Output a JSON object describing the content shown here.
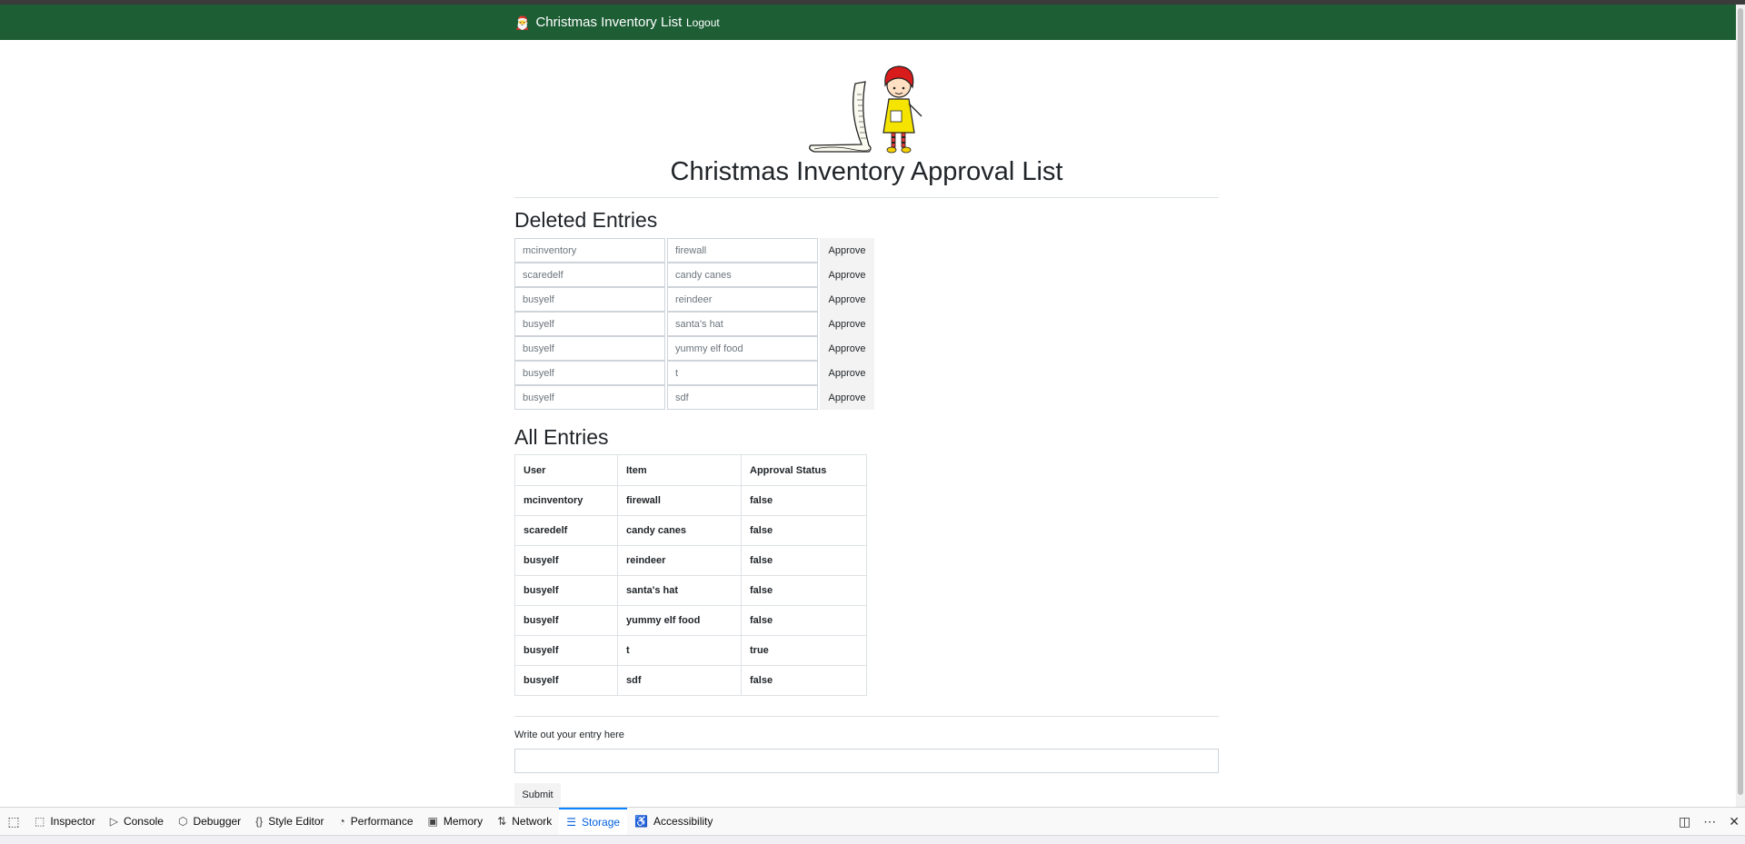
{
  "navbar": {
    "brand": "Christmas Inventory List",
    "logout": "Logout"
  },
  "page": {
    "title": "Christmas Inventory Approval List",
    "deleted_heading": "Deleted Entries",
    "all_heading": "All Entries"
  },
  "deleted_entries": [
    {
      "user": "mcinventory",
      "item": "firewall",
      "button": "Approve"
    },
    {
      "user": "scaredelf",
      "item": "candy canes",
      "button": "Approve"
    },
    {
      "user": "busyelf",
      "item": "reindeer",
      "button": "Approve"
    },
    {
      "user": "busyelf",
      "item": "santa's hat",
      "button": "Approve"
    },
    {
      "user": "busyelf",
      "item": "yummy elf food",
      "button": "Approve"
    },
    {
      "user": "busyelf",
      "item": "t",
      "button": "Approve"
    },
    {
      "user": "busyelf",
      "item": "sdf",
      "button": "Approve"
    }
  ],
  "table": {
    "headers": [
      "User",
      "Item",
      "Approval Status"
    ],
    "rows": [
      [
        "mcinventory",
        "firewall",
        "false"
      ],
      [
        "scaredelf",
        "candy canes",
        "false"
      ],
      [
        "busyelf",
        "reindeer",
        "false"
      ],
      [
        "busyelf",
        "santa's hat",
        "false"
      ],
      [
        "busyelf",
        "yummy elf food",
        "false"
      ],
      [
        "busyelf",
        "t",
        "true"
      ],
      [
        "busyelf",
        "sdf",
        "false"
      ]
    ]
  },
  "form": {
    "label": "Write out your entry here",
    "value": "",
    "submit": "Submit"
  },
  "devtools": {
    "tabs": [
      {
        "label": "Inspector",
        "icon": "inspector-icon",
        "glyph": "⬚",
        "active": false
      },
      {
        "label": "Console",
        "icon": "console-icon",
        "glyph": "▷",
        "active": false
      },
      {
        "label": "Debugger",
        "icon": "debugger-icon",
        "glyph": "⬡",
        "active": false
      },
      {
        "label": "Style Editor",
        "icon": "style-editor-icon",
        "glyph": "{}",
        "active": false
      },
      {
        "label": "Performance",
        "icon": "performance-icon",
        "glyph": "◔",
        "active": false
      },
      {
        "label": "Memory",
        "icon": "memory-icon",
        "glyph": "▣",
        "active": false
      },
      {
        "label": "Network",
        "icon": "network-icon",
        "glyph": "⇅",
        "active": false
      },
      {
        "label": "Storage",
        "icon": "storage-icon",
        "glyph": "☰",
        "active": true
      },
      {
        "label": "Accessibility",
        "icon": "accessibility-icon",
        "glyph": "♿",
        "active": false
      }
    ]
  },
  "colors": {
    "navbar": "#1d5e35",
    "active_tab": "#0060df"
  }
}
